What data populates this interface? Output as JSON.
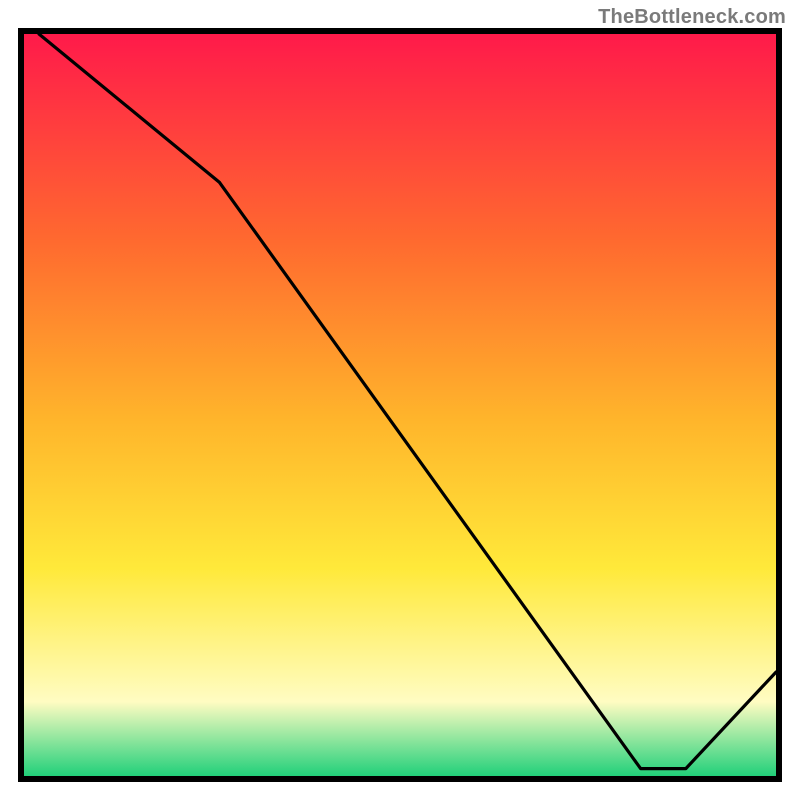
{
  "watermark": "TheBottleneck.com",
  "tick_label": "",
  "colors": {
    "gradient_top": "#ff1a4a",
    "gradient_mid1": "#ff6a2f",
    "gradient_mid2": "#ffb52b",
    "gradient_mid3": "#ffe93a",
    "gradient_light": "#fffcc2",
    "gradient_bottom": "#21d07a",
    "line": "#000000",
    "border": "#000000",
    "tick_text": "#c43a2f"
  },
  "chart_data": {
    "type": "line",
    "title": "",
    "xlabel": "",
    "ylabel": "",
    "xlim": [
      0,
      100
    ],
    "ylim": [
      0,
      100
    ],
    "series": [
      {
        "name": "curve",
        "x": [
          2,
          26,
          82,
          88,
          100
        ],
        "values": [
          100,
          80,
          1,
          1,
          14
        ]
      }
    ],
    "annotations": [
      {
        "text": "",
        "x": 85,
        "y": 2
      }
    ]
  }
}
